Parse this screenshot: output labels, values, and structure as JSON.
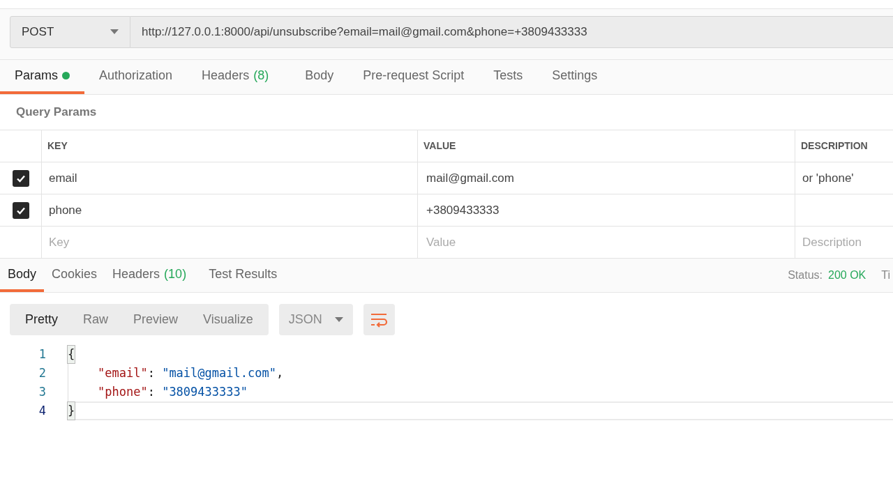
{
  "request": {
    "method": "POST",
    "url": "http://127.0.0.1:8000/api/unsubscribe?email=mail@gmail.com&phone=+3809433333"
  },
  "request_tabs": [
    {
      "label": "Params",
      "dot": true,
      "selected": true
    },
    {
      "label": "Authorization",
      "dot": false,
      "selected": false
    },
    {
      "label": "Headers",
      "count": "(8)",
      "dot": false,
      "selected": false
    },
    {
      "label": "Body",
      "dot": false,
      "selected": false
    },
    {
      "label": "Pre-request Script",
      "dot": false,
      "selected": false
    },
    {
      "label": "Tests",
      "dot": false,
      "selected": false
    },
    {
      "label": "Settings",
      "dot": false,
      "selected": false
    }
  ],
  "query_params": {
    "title": "Query Params",
    "columns": [
      "KEY",
      "VALUE",
      "DESCRIPTION"
    ],
    "rows": [
      {
        "checked": true,
        "key": "email",
        "value": "mail@gmail.com",
        "description": "or 'phone'"
      },
      {
        "checked": true,
        "key": "phone",
        "value": "+3809433333",
        "description": ""
      }
    ],
    "new_row": {
      "key_placeholder": "Key",
      "value_placeholder": "Value",
      "description_placeholder": "Description"
    }
  },
  "response_tabs": [
    {
      "label": "Body",
      "selected": true
    },
    {
      "label": "Cookies",
      "selected": false
    },
    {
      "label": "Headers",
      "count": "(10)",
      "selected": false
    },
    {
      "label": "Test Results",
      "selected": false
    }
  ],
  "status": {
    "label": "Status:",
    "value": "200 OK",
    "next": "Ti"
  },
  "view_modes": [
    {
      "label": "Pretty",
      "selected": true
    },
    {
      "label": "Raw",
      "selected": false
    },
    {
      "label": "Preview",
      "selected": false
    },
    {
      "label": "Visualize",
      "selected": false
    }
  ],
  "format": "JSON",
  "code_lines": [
    {
      "number": "1",
      "active": false,
      "tokens": [
        {
          "kind": "brace",
          "text": "{"
        }
      ]
    },
    {
      "number": "2",
      "active": false,
      "tokens": [
        {
          "kind": "key",
          "text": "\"email\""
        },
        {
          "kind": "punct",
          "text": ": "
        },
        {
          "kind": "string",
          "text": "\"mail@gmail.com\""
        },
        {
          "kind": "punct",
          "text": ","
        }
      ]
    },
    {
      "number": "3",
      "active": false,
      "tokens": [
        {
          "kind": "key",
          "text": "\"phone\""
        },
        {
          "kind": "punct",
          "text": ": "
        },
        {
          "kind": "string",
          "text": "\"3809433333\""
        }
      ]
    },
    {
      "number": "4",
      "active": true,
      "tokens": [
        {
          "kind": "brace",
          "text": "}"
        }
      ]
    }
  ]
}
